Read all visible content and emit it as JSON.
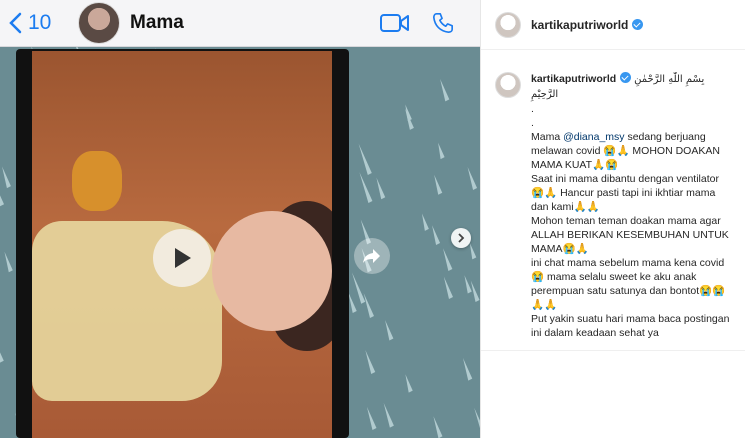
{
  "chat": {
    "back_count": "10",
    "contact_name": "Mama"
  },
  "instagram": {
    "header_username": "kartikaputriworld",
    "caption_username": "kartikaputriworld",
    "caption_lines": [
      "بِسْمِ اللّٰهِ الرَّحْمٰنِ الرَّحِيْمِ",
      ".",
      ".",
      "Mama @diana_msy sedang berjuang melawan covid 😭🙏 MOHON DOAKAN MAMA KUAT🙏😭",
      "Saat ini mama dibantu dengan ventilator😭🙏 Hancur pasti tapi ini ikhtiar mama dan kami🙏🙏",
      "Mohon teman teman doakan mama agar ALLAH BERIKAN KESEMBUHAN UNTUK MAMA😭🙏",
      "ini chat mama sebelum mama kena covid😭 mama selalu sweet ke aku anak perempuan satu satunya dan bontot😭😭🙏🙏",
      "Put yakin suatu hari mama baca postingan ini dalam keadaan sehat ya"
    ],
    "mention": "@diana_msy"
  },
  "colors": {
    "accent_blue": "#1c7cf0",
    "chat_bg": "#6a8c93",
    "verified_blue": "#3897f0"
  },
  "icons": [
    "chevron-left-icon",
    "video-call-icon",
    "phone-icon",
    "play-icon",
    "share-icon",
    "chevron-right-icon",
    "verified-badge-icon"
  ]
}
